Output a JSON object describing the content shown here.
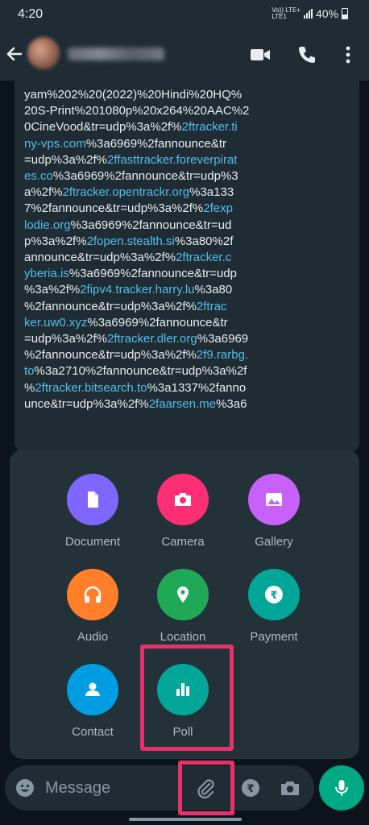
{
  "status_bar": {
    "time": "4:20",
    "network_top": "Vo)) LTE+",
    "network_bottom": "LTE1",
    "battery": "40%"
  },
  "header": {
    "contact_name_blurred": true,
    "icons": [
      "back-arrow-icon",
      "video-call-icon",
      "phone-icon",
      "more-vertical-icon"
    ]
  },
  "message": {
    "segments": [
      {
        "t": "yam%202%20(2022)%20Hindi%20HQ%",
        "link": false,
        "br": true
      },
      {
        "t": "20S-Print%201080p%20x264%20AAC%2",
        "link": false,
        "br": true
      },
      {
        "t": "0CineVood&tr=udp%3a%2f%",
        "link": false
      },
      {
        "t": "2ftracker.ti",
        "link": true,
        "br": true
      },
      {
        "t": "ny-vps.com",
        "link": true
      },
      {
        "t": "%3a6969%2fannounce&tr",
        "link": false,
        "br": true
      },
      {
        "t": "=udp%3a%2f%",
        "link": false
      },
      {
        "t": "2ffasttracker.foreverpirat",
        "link": true,
        "br": true
      },
      {
        "t": "es.co",
        "link": true
      },
      {
        "t": "%3a6969%2fannounce&tr=udp%3",
        "link": false,
        "br": true
      },
      {
        "t": "a%2f%",
        "link": false
      },
      {
        "t": "2ftracker.opentrackr.org",
        "link": true
      },
      {
        "t": "%3a133",
        "link": false,
        "br": true
      },
      {
        "t": "7%2fannounce&tr=udp%3a%2f%",
        "link": false
      },
      {
        "t": "2fexp",
        "link": true,
        "br": true
      },
      {
        "t": "lodie.org",
        "link": true
      },
      {
        "t": "%3a6969%2fannounce&tr=ud",
        "link": false,
        "br": true
      },
      {
        "t": "p%3a%2f%",
        "link": false
      },
      {
        "t": "2fopen.stealth.si",
        "link": true
      },
      {
        "t": "%3a80%2f",
        "link": false,
        "br": true
      },
      {
        "t": "announce&tr=udp%3a%2f%",
        "link": false
      },
      {
        "t": "2ftracker.c",
        "link": true,
        "br": true
      },
      {
        "t": "yberia.is",
        "link": true
      },
      {
        "t": "%3a6969%2fannounce&tr=udp",
        "link": false,
        "br": true
      },
      {
        "t": "%3a%2f%",
        "link": false
      },
      {
        "t": "2fipv4.tracker.harry.lu",
        "link": true
      },
      {
        "t": "%3a80",
        "link": false,
        "br": true
      },
      {
        "t": "%2fannounce&tr=udp%3a%2f%",
        "link": false
      },
      {
        "t": "2ftrac",
        "link": true,
        "br": true
      },
      {
        "t": "ker.uw0.xyz",
        "link": true
      },
      {
        "t": "%3a6969%2fannounce&tr",
        "link": false,
        "br": true
      },
      {
        "t": "=udp%3a%2f%",
        "link": false
      },
      {
        "t": "2ftracker.dler.org",
        "link": true
      },
      {
        "t": "%3a6969",
        "link": false,
        "br": true
      },
      {
        "t": "%2fannounce&tr=udp%3a%2f%",
        "link": false
      },
      {
        "t": "2f9.rarbg.",
        "link": true,
        "br": true
      },
      {
        "t": "to",
        "link": true
      },
      {
        "t": "%3a2710%2fannounce&tr=udp%3a%2f",
        "link": false,
        "br": true
      },
      {
        "t": "%",
        "link": false
      },
      {
        "t": "2ftracker.bitsearch.to",
        "link": true
      },
      {
        "t": "%3a1337%2fanno",
        "link": false,
        "br": true
      },
      {
        "t": "unce&tr=udp%3a%2f%",
        "link": false
      },
      {
        "t": "2faarsen.me",
        "link": true
      },
      {
        "t": "%3a6",
        "link": false,
        "br": true
      }
    ]
  },
  "attach_menu": {
    "items": [
      {
        "label": "Document",
        "icon": "document-icon",
        "color": "#7f66ff"
      },
      {
        "label": "Camera",
        "icon": "camera-icon",
        "color": "#fe2e74"
      },
      {
        "label": "Gallery",
        "icon": "gallery-icon",
        "color": "#c861fa"
      },
      {
        "label": "Audio",
        "icon": "headphones-icon",
        "color": "#ff7f2a"
      },
      {
        "label": "Location",
        "icon": "location-pin-icon",
        "color": "#1fa855"
      },
      {
        "label": "Payment",
        "icon": "rupee-icon",
        "color": "#02a698"
      },
      {
        "label": "Contact",
        "icon": "person-icon",
        "color": "#009de2"
      },
      {
        "label": "Poll",
        "icon": "poll-icon",
        "color": "#02a698"
      }
    ],
    "highlight_color": "#e8306b"
  },
  "composer": {
    "placeholder": "Message",
    "accent_color": "#00a884"
  }
}
